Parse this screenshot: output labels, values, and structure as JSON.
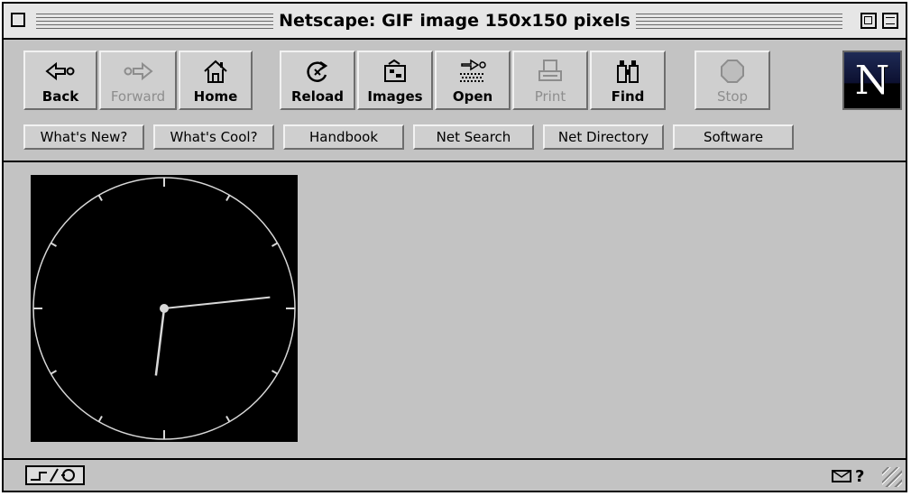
{
  "window": {
    "title": "Netscape: GIF image 150x150 pixels"
  },
  "toolbar": {
    "buttons": [
      {
        "label": "Back",
        "icon": "back-arrow-icon",
        "enabled": true
      },
      {
        "label": "Forward",
        "icon": "forward-arrow-icon",
        "enabled": false
      },
      {
        "label": "Home",
        "icon": "home-icon",
        "enabled": true
      },
      {
        "label": "Reload",
        "icon": "reload-icon",
        "enabled": true
      },
      {
        "label": "Images",
        "icon": "images-icon",
        "enabled": true
      },
      {
        "label": "Open",
        "icon": "open-icon",
        "enabled": true
      },
      {
        "label": "Print",
        "icon": "printer-icon",
        "enabled": false
      },
      {
        "label": "Find",
        "icon": "binoculars-icon",
        "enabled": true
      },
      {
        "label": "Stop",
        "icon": "stop-icon",
        "enabled": false
      }
    ],
    "logo": "N"
  },
  "directory": {
    "buttons": [
      {
        "label": "What's New?"
      },
      {
        "label": "What's Cool?"
      },
      {
        "label": "Handbook"
      },
      {
        "label": "Net Search"
      },
      {
        "label": "Net Directory"
      },
      {
        "label": "Software"
      }
    ]
  },
  "content": {
    "image": {
      "type": "analog clock",
      "background": "#000000",
      "face_color": "#d8d8d8",
      "time_shown": "6:14"
    }
  },
  "statusbar": {
    "right_icons": [
      "mail-icon",
      "help-icon"
    ]
  },
  "colors": {
    "window_gray": "#c3c3c3",
    "button_face": "#cfcfcf",
    "disabled_text": "#8d8d8d"
  }
}
